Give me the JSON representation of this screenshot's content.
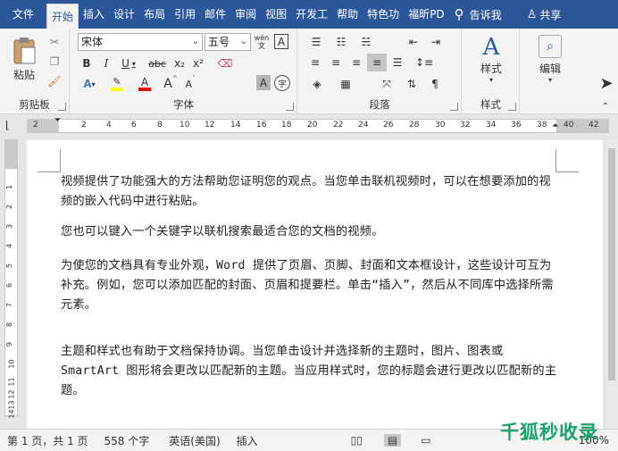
{
  "tabs": [
    "文件",
    "开始",
    "插入",
    "设计",
    "布局",
    "引用",
    "邮件",
    "审阅",
    "视图",
    "开发工",
    "帮助",
    "特色功",
    "福昕PD"
  ],
  "active_tab": "开始",
  "tell_me": "告诉我",
  "share": "共享",
  "clipboard": {
    "paste": "粘贴",
    "label": "剪贴板"
  },
  "font": {
    "name": "宋体",
    "size": "五号",
    "label": "字体",
    "bold": "B",
    "italic": "I",
    "underline": "U",
    "strike": "abc",
    "subscript": "x₂",
    "superscript": "x²",
    "grow": "A",
    "shrink": "A",
    "wen": "wén",
    "A_border": "A"
  },
  "paragraph": {
    "label": "段落"
  },
  "styles": {
    "label": "样式",
    "button": "样式"
  },
  "editing": {
    "button": "编辑"
  },
  "ruler_numbers": [
    "2",
    "2",
    "4",
    "6",
    "8",
    "10",
    "12",
    "14",
    "16",
    "18",
    "20",
    "22",
    "24",
    "26",
    "28",
    "30",
    "32",
    "34",
    "36",
    "38",
    "40",
    "42"
  ],
  "vruler_numbers": [
    "1",
    "2",
    "3",
    "4",
    "5",
    "6",
    "7",
    "8",
    "9",
    "10",
    "11",
    "12",
    "13",
    "14"
  ],
  "document": {
    "p1": "视频提供了功能强大的方法帮助您证明您的观点。当您单击联机视频时，可以在想要添加的视频的嵌入代码中进行粘贴。",
    "p2": "您也可以键入一个关键字以联机搜索最适合您的文档的视频。",
    "p3": "为使您的文档具有专业外观，Word 提供了页眉、页脚、封面和文本框设计，这些设计可互为补充。例如，您可以添加匹配的封面、页眉和提要栏。单击“插入”，然后从不同库中选择所需元素。",
    "p4": "主题和样式也有助于文档保持协调。当您单击设计并选择新的主题时，图片、图表或 SmartArt 图形将会更改以匹配新的主题。当应用样式时，您的标题会进行更改以匹配新的主题。"
  },
  "status": {
    "page": "第 1 页，共 1 页",
    "words": "558 个字",
    "lang": "英语(美国)",
    "mode": "插入",
    "zoom": "100%"
  },
  "watermark": "千狐秒收录",
  "colors": {
    "titlebar": "#2b579a",
    "highlight": "#ffff00",
    "font_color": "#ff0000"
  }
}
